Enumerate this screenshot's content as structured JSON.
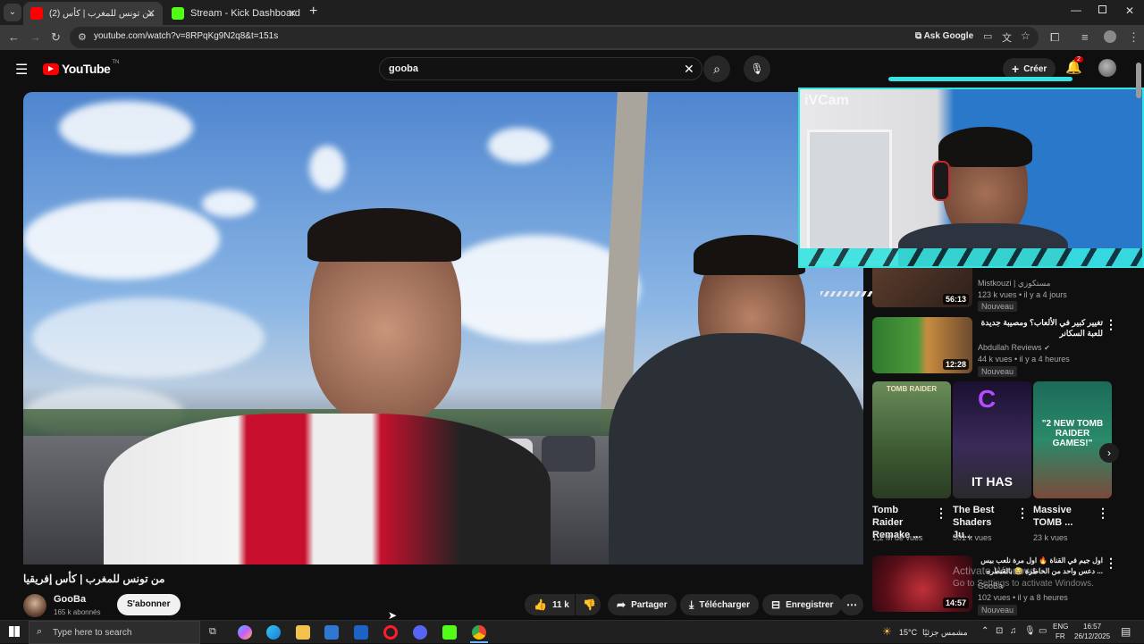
{
  "browser": {
    "tabs": [
      {
        "title": "(2) من تونس للمغرب | كأس",
        "active": true
      },
      {
        "title": "Stream - Kick Dashboard",
        "active": false
      }
    ],
    "url": "youtube.com/watch?v=8RPqKg9N2q8&t=151s",
    "ask_google": "Ask Google"
  },
  "youtube": {
    "logo": "YouTube",
    "logo_region": "TN",
    "search_value": "gooba",
    "create_label": "Créer",
    "notification_count": "2"
  },
  "overlay": {
    "webcam_label": "iVCam"
  },
  "video": {
    "title": "من تونس للمغرب | كأس إفريقيا",
    "channel": "GooBa",
    "subscribers": "165 k abonnés",
    "subscribe_label": "S'abonner",
    "likes": "11 k",
    "share_label": "Partager",
    "download_label": "Télécharger",
    "save_label": "Enregistrer"
  },
  "recommendations": {
    "first": {
      "channel": "Mistkouzi | مستكوزي",
      "meta": "123 k vues • il y a 4 jours",
      "badge": "Nouveau",
      "duration": "56:13"
    },
    "second": {
      "title": "تغيير كبير في الألعاب؟ ومصيبة جديدة للعبة السكانر",
      "channel": "Abdullah Reviews",
      "meta": "44 k vues • il y a 4 heures",
      "badge": "Nouveau",
      "duration": "12:28"
    },
    "shorts": [
      {
        "title": "Tomb Raider Remake ...",
        "views": "1,2 M de vues",
        "thumb_text": "TOMB RAIDER"
      },
      {
        "title": "The Best Shaders Ju...",
        "views": "501 k vues",
        "thumb_text": "IT HAS"
      },
      {
        "title": "Massive TOMB ...",
        "views": "23 k vues",
        "thumb_text": "\"2 NEW TOMB RAIDER GAMES!\""
      }
    ],
    "third": {
      "title": "اول جيم في القناة 🔥 اول مرة نلعب بيس ... دعس واحد من الخاطرة 😂 بالقنطره",
      "channel": "GooBa",
      "meta": "102 vues • il y a 8 heures",
      "badge": "Nouveau",
      "duration": "14:57"
    }
  },
  "watermark": {
    "line1": "Activate Windows",
    "line2": "Go to Settings to activate Windows."
  },
  "taskbar": {
    "search_placeholder": "Type here to search",
    "weather": "15°C",
    "weather_desc": "مشمس جزئيًا",
    "lang_top": "ENG",
    "lang_bottom": "FR",
    "time": "16:57",
    "date": "26/12/2025"
  },
  "colors": {
    "youtube_red": "#ff0000",
    "kick_green": "#53fc18",
    "cyan_overlay": "#36e3e0"
  }
}
